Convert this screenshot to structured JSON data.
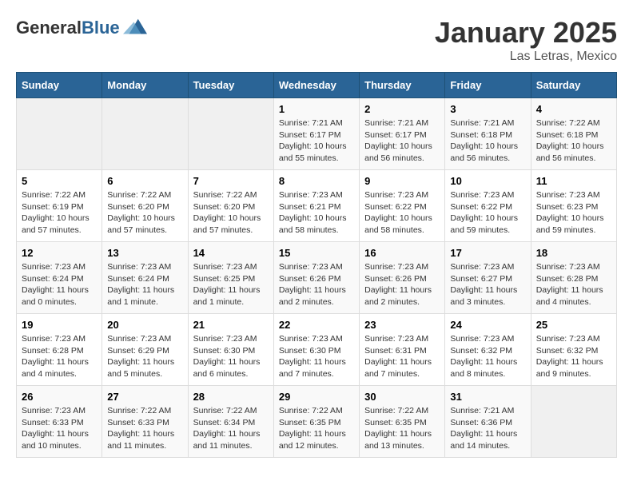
{
  "header": {
    "logo_general": "General",
    "logo_blue": "Blue",
    "title": "January 2025",
    "subtitle": "Las Letras, Mexico"
  },
  "days_of_week": [
    "Sunday",
    "Monday",
    "Tuesday",
    "Wednesday",
    "Thursday",
    "Friday",
    "Saturday"
  ],
  "weeks": [
    [
      {
        "day": "",
        "info": ""
      },
      {
        "day": "",
        "info": ""
      },
      {
        "day": "",
        "info": ""
      },
      {
        "day": "1",
        "info": "Sunrise: 7:21 AM\nSunset: 6:17 PM\nDaylight: 10 hours\nand 55 minutes."
      },
      {
        "day": "2",
        "info": "Sunrise: 7:21 AM\nSunset: 6:17 PM\nDaylight: 10 hours\nand 56 minutes."
      },
      {
        "day": "3",
        "info": "Sunrise: 7:21 AM\nSunset: 6:18 PM\nDaylight: 10 hours\nand 56 minutes."
      },
      {
        "day": "4",
        "info": "Sunrise: 7:22 AM\nSunset: 6:18 PM\nDaylight: 10 hours\nand 56 minutes."
      }
    ],
    [
      {
        "day": "5",
        "info": "Sunrise: 7:22 AM\nSunset: 6:19 PM\nDaylight: 10 hours\nand 57 minutes."
      },
      {
        "day": "6",
        "info": "Sunrise: 7:22 AM\nSunset: 6:20 PM\nDaylight: 10 hours\nand 57 minutes."
      },
      {
        "day": "7",
        "info": "Sunrise: 7:22 AM\nSunset: 6:20 PM\nDaylight: 10 hours\nand 57 minutes."
      },
      {
        "day": "8",
        "info": "Sunrise: 7:23 AM\nSunset: 6:21 PM\nDaylight: 10 hours\nand 58 minutes."
      },
      {
        "day": "9",
        "info": "Sunrise: 7:23 AM\nSunset: 6:22 PM\nDaylight: 10 hours\nand 58 minutes."
      },
      {
        "day": "10",
        "info": "Sunrise: 7:23 AM\nSunset: 6:22 PM\nDaylight: 10 hours\nand 59 minutes."
      },
      {
        "day": "11",
        "info": "Sunrise: 7:23 AM\nSunset: 6:23 PM\nDaylight: 10 hours\nand 59 minutes."
      }
    ],
    [
      {
        "day": "12",
        "info": "Sunrise: 7:23 AM\nSunset: 6:24 PM\nDaylight: 11 hours\nand 0 minutes."
      },
      {
        "day": "13",
        "info": "Sunrise: 7:23 AM\nSunset: 6:24 PM\nDaylight: 11 hours\nand 1 minute."
      },
      {
        "day": "14",
        "info": "Sunrise: 7:23 AM\nSunset: 6:25 PM\nDaylight: 11 hours\nand 1 minute."
      },
      {
        "day": "15",
        "info": "Sunrise: 7:23 AM\nSunset: 6:26 PM\nDaylight: 11 hours\nand 2 minutes."
      },
      {
        "day": "16",
        "info": "Sunrise: 7:23 AM\nSunset: 6:26 PM\nDaylight: 11 hours\nand 2 minutes."
      },
      {
        "day": "17",
        "info": "Sunrise: 7:23 AM\nSunset: 6:27 PM\nDaylight: 11 hours\nand 3 minutes."
      },
      {
        "day": "18",
        "info": "Sunrise: 7:23 AM\nSunset: 6:28 PM\nDaylight: 11 hours\nand 4 minutes."
      }
    ],
    [
      {
        "day": "19",
        "info": "Sunrise: 7:23 AM\nSunset: 6:28 PM\nDaylight: 11 hours\nand 4 minutes."
      },
      {
        "day": "20",
        "info": "Sunrise: 7:23 AM\nSunset: 6:29 PM\nDaylight: 11 hours\nand 5 minutes."
      },
      {
        "day": "21",
        "info": "Sunrise: 7:23 AM\nSunset: 6:30 PM\nDaylight: 11 hours\nand 6 minutes."
      },
      {
        "day": "22",
        "info": "Sunrise: 7:23 AM\nSunset: 6:30 PM\nDaylight: 11 hours\nand 7 minutes."
      },
      {
        "day": "23",
        "info": "Sunrise: 7:23 AM\nSunset: 6:31 PM\nDaylight: 11 hours\nand 7 minutes."
      },
      {
        "day": "24",
        "info": "Sunrise: 7:23 AM\nSunset: 6:32 PM\nDaylight: 11 hours\nand 8 minutes."
      },
      {
        "day": "25",
        "info": "Sunrise: 7:23 AM\nSunset: 6:32 PM\nDaylight: 11 hours\nand 9 minutes."
      }
    ],
    [
      {
        "day": "26",
        "info": "Sunrise: 7:23 AM\nSunset: 6:33 PM\nDaylight: 11 hours\nand 10 minutes."
      },
      {
        "day": "27",
        "info": "Sunrise: 7:22 AM\nSunset: 6:33 PM\nDaylight: 11 hours\nand 11 minutes."
      },
      {
        "day": "28",
        "info": "Sunrise: 7:22 AM\nSunset: 6:34 PM\nDaylight: 11 hours\nand 11 minutes."
      },
      {
        "day": "29",
        "info": "Sunrise: 7:22 AM\nSunset: 6:35 PM\nDaylight: 11 hours\nand 12 minutes."
      },
      {
        "day": "30",
        "info": "Sunrise: 7:22 AM\nSunset: 6:35 PM\nDaylight: 11 hours\nand 13 minutes."
      },
      {
        "day": "31",
        "info": "Sunrise: 7:21 AM\nSunset: 6:36 PM\nDaylight: 11 hours\nand 14 minutes."
      },
      {
        "day": "",
        "info": ""
      }
    ]
  ]
}
